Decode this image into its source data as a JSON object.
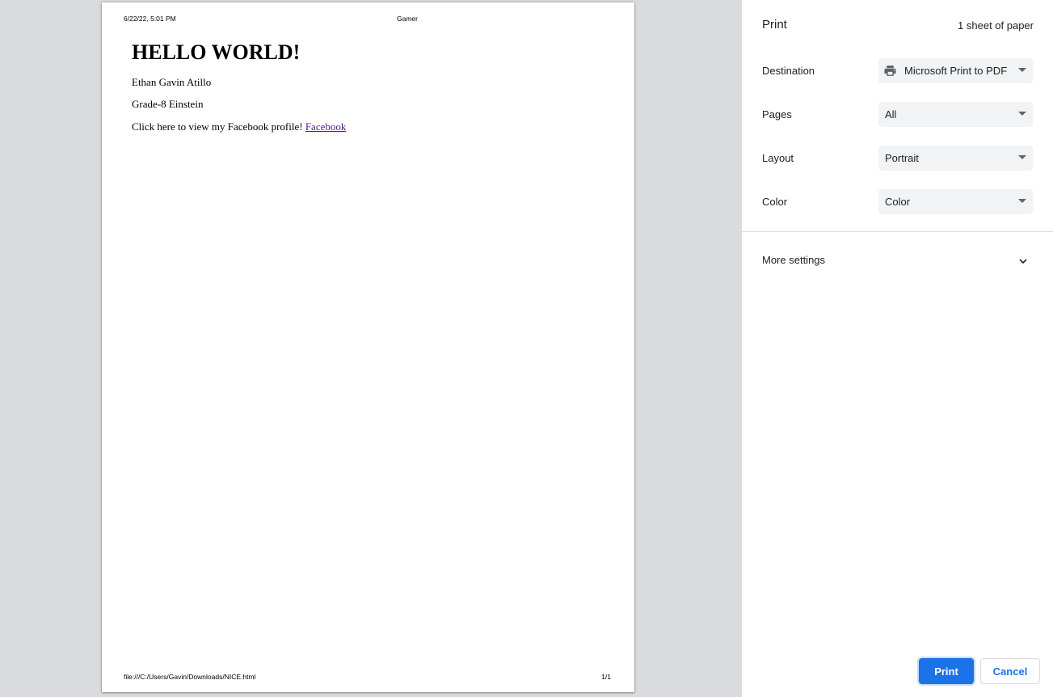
{
  "preview": {
    "header_date": "6/22/22, 5:01 PM",
    "header_title": "Gamer",
    "heading": "HELLO WORLD!",
    "line1": "Ethan Gavin Atillo",
    "line2": "Grade-8 Einstein",
    "line3_text": "Click here to view my Facebook profile!",
    "line3_link": "Facebook",
    "footer_url": "file:///C:/Users/Gavin/Downloads/NICE.html",
    "footer_page": "1/1"
  },
  "settings": {
    "title": "Print",
    "sheet_count": "1 sheet of paper",
    "destination": {
      "label": "Destination",
      "value": "Microsoft Print to PDF",
      "icon": "printer-icon"
    },
    "pages": {
      "label": "Pages",
      "value": "All"
    },
    "layout": {
      "label": "Layout",
      "value": "Portrait"
    },
    "color": {
      "label": "Color",
      "value": "Color"
    },
    "more_settings": {
      "label": "More settings",
      "icon": "chevron-down-icon"
    },
    "print_button": "Print",
    "cancel_button": "Cancel"
  },
  "colors": {
    "accent": "#1a73e8",
    "preview_background": "#dadbde",
    "select_background": "#f1f3f4",
    "visited_link": "#551a8b"
  }
}
